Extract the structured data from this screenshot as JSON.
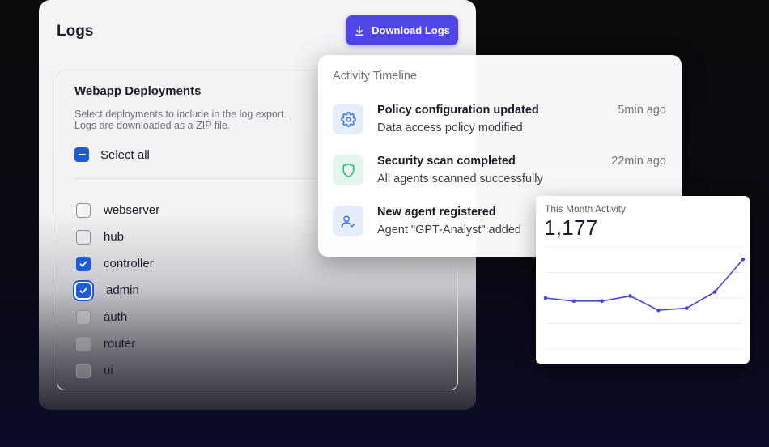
{
  "logs": {
    "title": "Logs",
    "download_label": "Download Logs",
    "deployments": {
      "title": "Webapp Deployments",
      "description_line1": "Select deployments to include in the log export.",
      "description_line2": "Logs are downloaded as a ZIP file.",
      "select_all_label": "Select all",
      "items": [
        {
          "label": "webserver",
          "checked": false
        },
        {
          "label": "hub",
          "checked": false
        },
        {
          "label": "controller",
          "checked": true
        },
        {
          "label": "admin",
          "checked": true
        },
        {
          "label": "auth",
          "checked": false
        },
        {
          "label": "router",
          "checked": false
        },
        {
          "label": "ui",
          "checked": false
        }
      ]
    }
  },
  "timeline": {
    "header": "Activity Timeline",
    "items": [
      {
        "title": "Policy configuration updated",
        "subtitle": "Data access policy modified",
        "time": "5min ago",
        "icon": "gear-icon"
      },
      {
        "title": "Security scan completed",
        "subtitle": "All agents scanned successfully",
        "time": "22min ago",
        "icon": "shield-icon"
      },
      {
        "title": "New agent registered",
        "subtitle": "Agent \"GPT-Analyst\" added",
        "time": "",
        "icon": "user-check-icon"
      }
    ]
  },
  "activity": {
    "label": "This Month Activity",
    "value": "1,177"
  },
  "colors": {
    "accent": "#4f46e5",
    "checkbox": "#1d5bd6",
    "line": "#4a44d6"
  },
  "chart_data": {
    "type": "line",
    "title": "",
    "xlabel": "",
    "ylabel": "",
    "x": [
      1,
      2,
      3,
      4,
      5,
      6,
      7,
      8
    ],
    "series": [
      {
        "values": [
          50,
          47,
          47,
          52,
          38,
          40,
          56,
          88
        ]
      }
    ],
    "ylim": [
      0,
      100
    ],
    "grid": true
  }
}
